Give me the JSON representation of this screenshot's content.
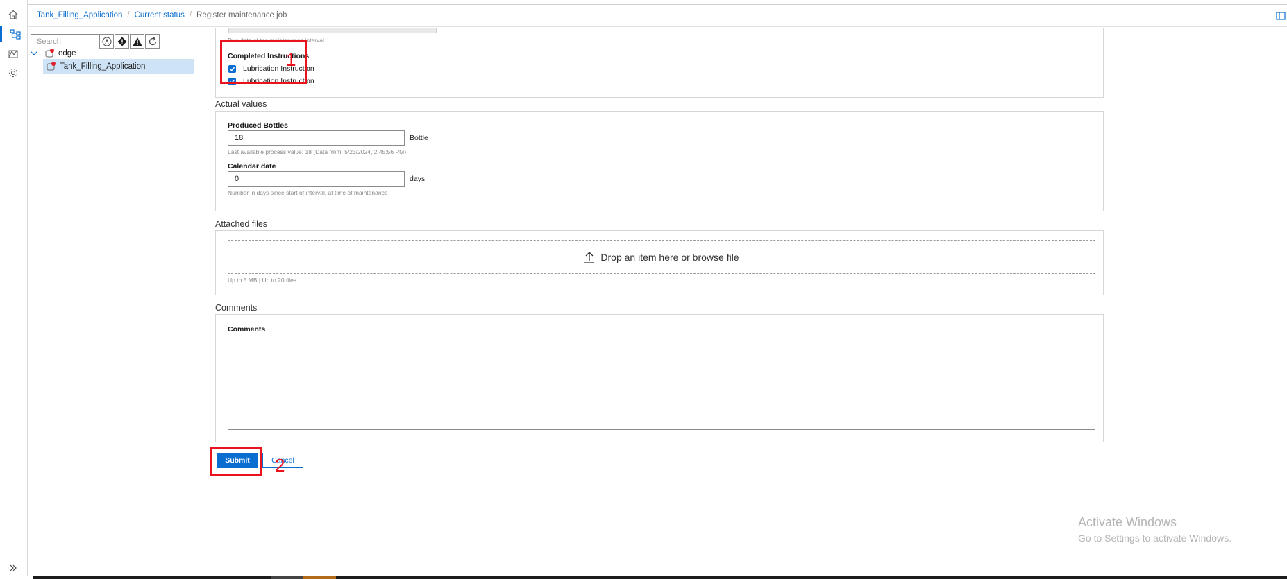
{
  "breadcrumb": {
    "items": [
      "Tank_Filling_Application",
      "Current status"
    ],
    "current": "Register maintenance job"
  },
  "tree": {
    "search_placeholder": "Search",
    "nodes": [
      {
        "label": "edge"
      },
      {
        "label": "Tank_Filling_Application"
      }
    ]
  },
  "form": {
    "due_date_hint": "Due date of the maintenance interval",
    "completed_instructions": {
      "label": "Completed Instructions",
      "items": [
        {
          "label": "Lubrication Instruction",
          "checked": true
        },
        {
          "label": "Lubrication Instruction",
          "checked": true
        }
      ]
    },
    "actual_values": {
      "title": "Actual values",
      "produced_bottles": {
        "label": "Produced Bottles",
        "value": "18",
        "unit": "Bottle",
        "hint": "Last available process value: 18 (Data from: 5/23/2024, 2:45:56 PM)"
      },
      "calendar_date": {
        "label": "Calendar date",
        "value": "0",
        "unit": "days",
        "hint": "Number in days since start of interval, at time of maintenance"
      }
    },
    "attached_files": {
      "title": "Attached files",
      "drop_text": "Drop an item here or browse file",
      "hint": "Up to 5 MB | Up to 20 files"
    },
    "comments": {
      "title": "Comments",
      "label": "Comments",
      "value": ""
    },
    "submit_label": "Submit",
    "cancel_label": "Cancel"
  },
  "annotations": {
    "label_1": "1",
    "label_2": "2",
    "color": "#e8131f"
  },
  "watermark": {
    "line1": "Activate Windows",
    "line2": "Go to Settings to activate Windows."
  },
  "colors": {
    "accent": "#0a6ed1",
    "selection": "#cfe3f7",
    "status_dot": "#e0202a"
  }
}
